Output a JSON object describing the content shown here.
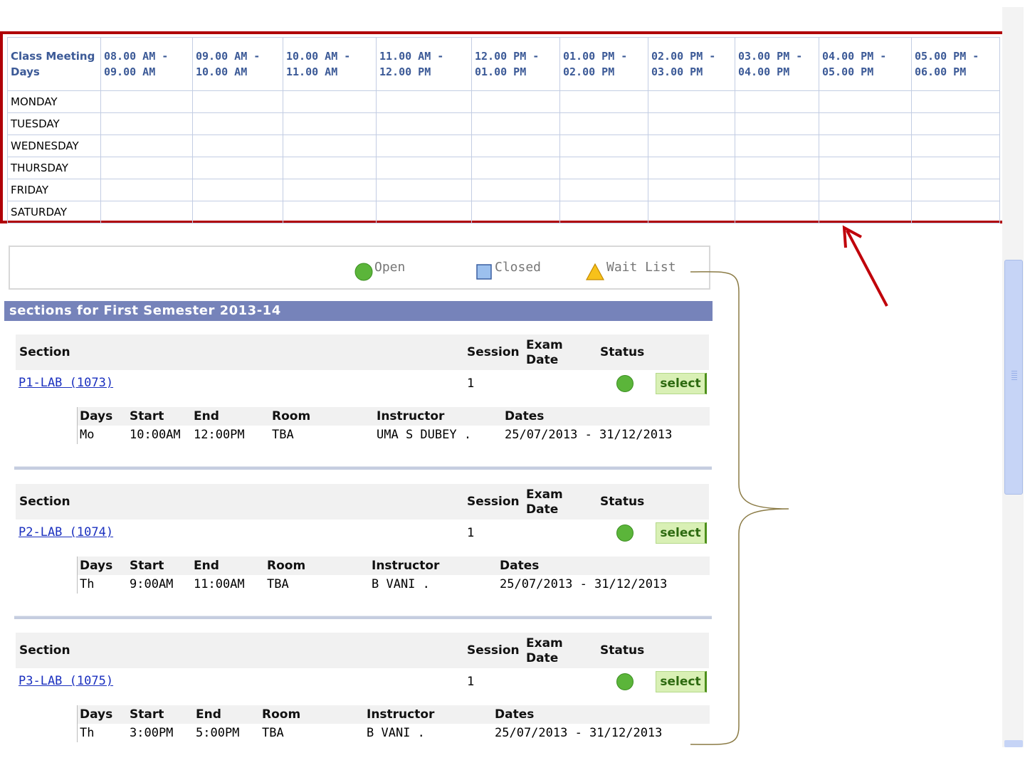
{
  "timetable": {
    "corner": "Class Meeting Days",
    "timeslots": [
      "08.00 AM - 09.00 AM",
      "09.00 AM - 10.00 AM",
      "10.00 AM - 11.00 AM",
      "11.00 AM - 12.00 PM",
      "12.00 PM - 01.00 PM",
      "01.00 PM - 02.00 PM",
      "02.00 PM - 03.00 PM",
      "03.00 PM - 04.00 PM",
      "04.00 PM - 05.00 PM",
      "05.00 PM - 06.00 PM"
    ],
    "days": [
      "MONDAY",
      "TUESDAY",
      "WEDNESDAY",
      "THURSDAY",
      "FRIDAY",
      "SATURDAY"
    ]
  },
  "legend": {
    "open": "Open",
    "closed": "Closed",
    "waitlist": "Wait List"
  },
  "colors": {
    "highlight": "#b00008",
    "open": "#5bb53a",
    "closed": "#9cc0ee",
    "waitlist": "#f7c11a",
    "title_bar": "#7683ba"
  },
  "sections_title": "sections for First Semester 2013-14",
  "headers": {
    "section": "Section",
    "session": "Session",
    "exam": "Exam",
    "date": "Date",
    "status": "Status",
    "days": "Days",
    "start": "Start",
    "end": "End",
    "room": "Room",
    "instructor": "Instructor",
    "dates": "Dates"
  },
  "select_label": "select",
  "sections": [
    {
      "name": "P1-LAB (1073)",
      "session": "1",
      "days": "Mo",
      "start": "10:00AM",
      "end": "12:00PM",
      "room": "TBA",
      "instructor": "UMA S DUBEY .",
      "dates": "25/07/2013 - 31/12/2013"
    },
    {
      "name": "P2-LAB (1074)",
      "session": "1",
      "days": "Th",
      "start": "9:00AM",
      "end": "11:00AM",
      "room": "TBA",
      "instructor": "B VANI .",
      "dates": "25/07/2013 - 31/12/2013"
    },
    {
      "name": "P3-LAB (1075)",
      "session": "1",
      "days": "Th",
      "start": "3:00PM",
      "end": "5:00PM",
      "room": "TBA",
      "instructor": "B VANI .",
      "dates": "25/07/2013 - 31/12/2013"
    }
  ]
}
